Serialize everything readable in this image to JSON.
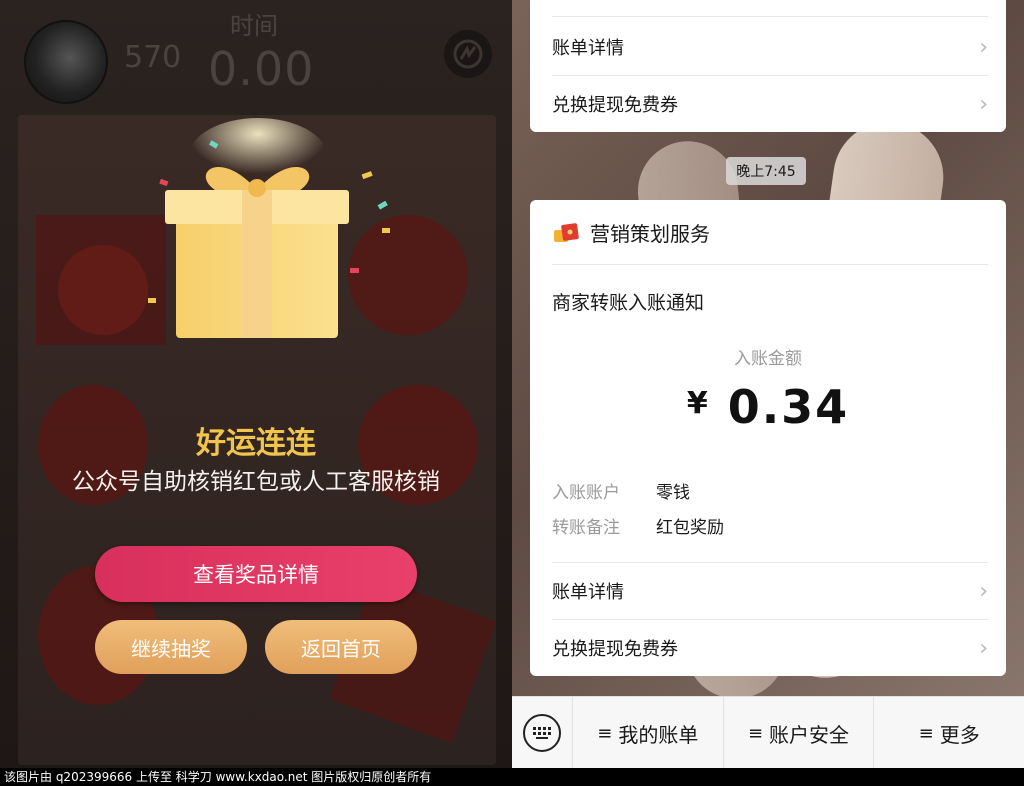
{
  "left": {
    "score": "570",
    "time_label": "时间",
    "time_value": "0.00",
    "result_title": "好运连连",
    "result_subtitle": "公众号自助核销红包或人工客服核销",
    "btn_view_prize": "查看奖品详情",
    "btn_continue": "继续抽奖",
    "btn_home": "返回首页",
    "colors": {
      "title": "#f1c54a",
      "primary_button": "#e03a64",
      "secondary_button": "#e8ad67"
    }
  },
  "right": {
    "top_card": {
      "rows": [
        "账单详情",
        "兑换提现免费券"
      ]
    },
    "time_chip": "晚上7:45",
    "message_card": {
      "service_name": "营销策划服务",
      "notice_title": "商家转账入账通知",
      "amount_label": "入账金额",
      "currency": "¥",
      "amount": "0.34",
      "fields": [
        {
          "key": "入账账户",
          "value": "零钱"
        },
        {
          "key": "转账备注",
          "value": "红包奖励"
        }
      ],
      "rows": [
        "账单详情",
        "兑换提现免费券"
      ]
    },
    "bottom_menu": [
      "我的账单",
      "账户安全",
      "更多"
    ],
    "menu_icon_glyph": "≡"
  },
  "watermark": "该图片由 q202399666 上传至 科学刀 www.kxdao.net 图片版权归原创者所有"
}
